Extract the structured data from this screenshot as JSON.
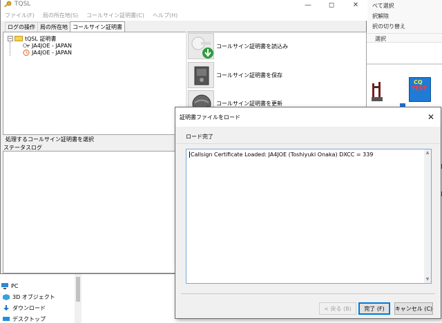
{
  "background": {
    "ribbon_lines": [
      "べて選択",
      "択解除",
      "択の切り替え",
      "選択"
    ],
    "cq_icon_text": [
      "CQ",
      "TEST"
    ],
    "nav_items": [
      {
        "label": "PC",
        "icon": "pc-icon"
      },
      {
        "label": "3D オブジェクト",
        "icon": "3d-objects-icon"
      },
      {
        "label": "ダウンロード",
        "icon": "download-icon"
      },
      {
        "label": "デスクトップ",
        "icon": "desktop-icon"
      }
    ]
  },
  "tqsl": {
    "title": "TQSL",
    "menu": [
      "ファイル(F)",
      "局の所在地(S)",
      "コールサイン証明書(C)",
      "ヘルプ(H)"
    ],
    "tabs": [
      "ログの操作",
      "局の所在地",
      "コールサイン証明書"
    ],
    "active_tab": "コールサイン証明書",
    "tree": {
      "root": "tQSL 証明書",
      "items": [
        "JA4JOE - JAPAN",
        "JA4JOE - JAPAN"
      ]
    },
    "actions": [
      {
        "label": "コールサイン証明書を読込み",
        "icon": "certificate-load-icon"
      },
      {
        "label": "コールサイン証明書を保存",
        "icon": "certificate-save-icon"
      },
      {
        "label": "コールサイン証明書を更新",
        "icon": "certificate-renew-icon"
      }
    ],
    "select_prompt": "処理するコールサイン証明書を選択",
    "status_log_label": "ステータスログ"
  },
  "dialog": {
    "title": "証明書ファイルをロード",
    "heading": "ロード完了",
    "text": "Callsign Certificate Loaded:  JA4JOE (Toshiyuki Onaka)  DXCC = 339",
    "buttons": {
      "back": "< 戻る (B)",
      "finish": "完了 (F)",
      "cancel": "キャンセル (C)"
    }
  },
  "colors": {
    "accent": "#0078d7",
    "folder": "#f3d34f",
    "check_green": "#2e9b3e"
  }
}
